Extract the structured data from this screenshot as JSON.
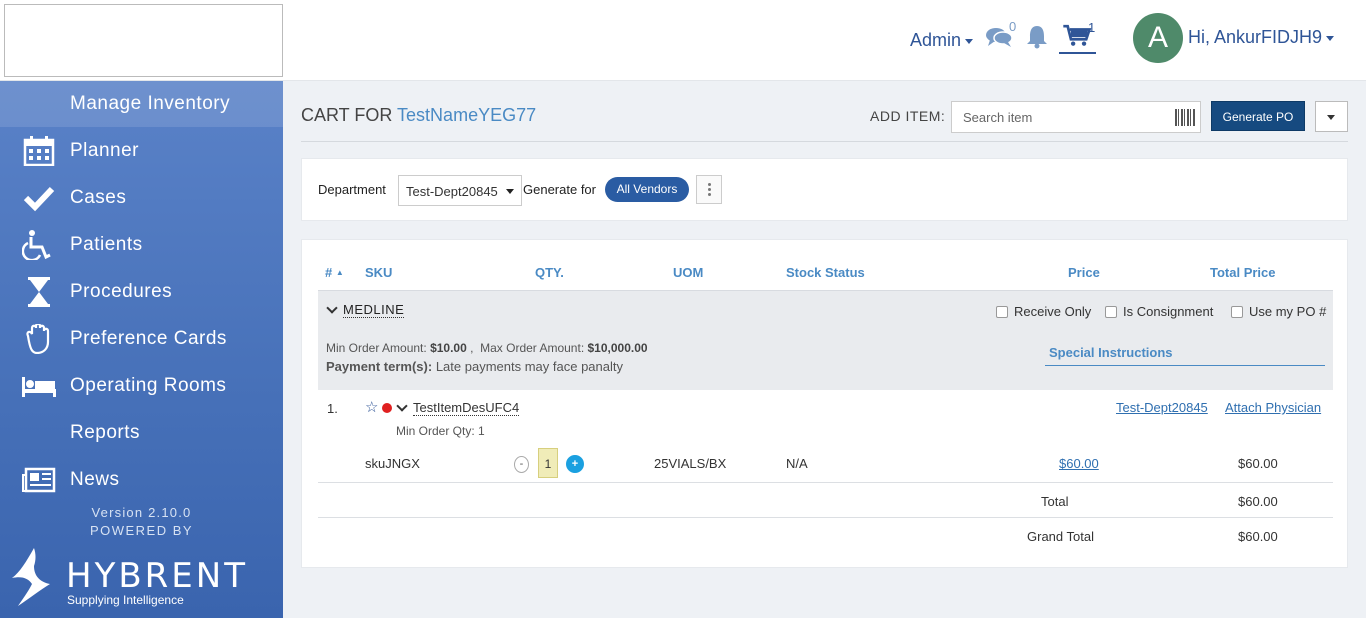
{
  "header": {
    "admin_label": "Admin",
    "chat_count": "0",
    "cart_count": "1",
    "avatar_letter": "A",
    "greeting": "Hi, AnkurFIDJH9"
  },
  "sidebar": {
    "items": [
      {
        "label": "Manage Inventory",
        "icon": "inventory-icon"
      },
      {
        "label": "Planner",
        "icon": "calendar-icon"
      },
      {
        "label": "Cases",
        "icon": "checkmark-icon"
      },
      {
        "label": "Patients",
        "icon": "wheelchair-icon"
      },
      {
        "label": "Procedures",
        "icon": "hourglass-icon"
      },
      {
        "label": "Preference Cards",
        "icon": "hand-icon"
      },
      {
        "label": "Operating Rooms",
        "icon": "bed-icon"
      },
      {
        "label": "Reports",
        "icon": "reports-icon"
      },
      {
        "label": "News",
        "icon": "newspaper-icon"
      }
    ],
    "version": "Version 2.10.0",
    "powered_by": "POWERED BY",
    "brand": "HYBRENT",
    "brand_tagline": "Supplying Intelligence"
  },
  "cart": {
    "title_prefix": "CART FOR",
    "title_name": "TestNameYEG77",
    "add_item_label": "ADD ITEM:",
    "search_placeholder": "Search item",
    "generate_po": "Generate PO"
  },
  "filters": {
    "department_label": "Department",
    "department_value": "Test-Dept20845",
    "generate_for_label": "Generate for",
    "vendor_pill": "All Vendors"
  },
  "table": {
    "headers": {
      "num": "#",
      "sku": "SKU",
      "qty": "QTY.",
      "uom": "UOM",
      "stock": "Stock Status",
      "price": "Price",
      "total": "Total Price"
    },
    "vendor": {
      "name": "MEDLINE",
      "receive_only": "Receive Only",
      "consignment": "Is Consignment",
      "use_po": "Use my PO #",
      "min_label": "Min Order Amount:",
      "min_value": "$10.00",
      "max_label": "Max Order Amount:",
      "max_value": "$10,000.00",
      "terms_label": "Payment term(s):",
      "terms_value": "Late payments may face panalty",
      "special_instructions": "Special Instructions"
    },
    "item": {
      "num": "1.",
      "name": "TestItemDesUFC4",
      "min_qty": "Min Order Qty: 1",
      "dept_link": "Test-Dept20845",
      "attach_link": "Attach Physician",
      "sku": "skuJNGX",
      "qty": "1",
      "uom": "25VIALS/BX",
      "stock": "N/A",
      "price": "$60.00",
      "total": "$60.00"
    },
    "total_label": "Total",
    "total_value": "$60.00",
    "grand_total_label": "Grand Total",
    "grand_total_value": "$60.00"
  },
  "colors": {
    "accent": "#2f5597",
    "link": "#4a8ac4",
    "button": "#164a80",
    "sidebar": "#4670b8"
  }
}
